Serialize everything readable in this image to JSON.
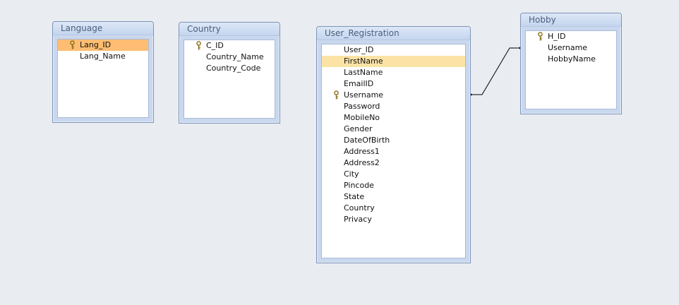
{
  "tables": {
    "language": {
      "title": "Language",
      "fields": [
        {
          "name": "Lang_ID",
          "key": true,
          "highlight": "strong"
        },
        {
          "name": "Lang_Name",
          "key": false
        }
      ]
    },
    "country": {
      "title": "Country",
      "fields": [
        {
          "name": "C_ID",
          "key": true
        },
        {
          "name": "Country_Name",
          "key": false
        },
        {
          "name": "Country_Code",
          "key": false
        }
      ]
    },
    "user_registration": {
      "title": "User_Registration",
      "fields": [
        {
          "name": "User_ID",
          "key": false
        },
        {
          "name": "FirstName",
          "key": false,
          "highlight": "soft"
        },
        {
          "name": "LastName",
          "key": false
        },
        {
          "name": "EmailID",
          "key": false
        },
        {
          "name": "Username",
          "key": true
        },
        {
          "name": "Password",
          "key": false
        },
        {
          "name": "MobileNo",
          "key": false
        },
        {
          "name": "Gender",
          "key": false
        },
        {
          "name": "DateOfBirth",
          "key": false
        },
        {
          "name": "Address1",
          "key": false
        },
        {
          "name": "Address2",
          "key": false
        },
        {
          "name": "City",
          "key": false
        },
        {
          "name": "Pincode",
          "key": false
        },
        {
          "name": "State",
          "key": false
        },
        {
          "name": "Country",
          "key": false
        },
        {
          "name": "Privacy",
          "key": false
        }
      ]
    },
    "hobby": {
      "title": "Hobby",
      "fields": [
        {
          "name": "H_ID",
          "key": true
        },
        {
          "name": "Username",
          "key": false
        },
        {
          "name": "HobbyName",
          "key": false
        }
      ]
    }
  },
  "relationships": [
    {
      "from_table": "user_registration",
      "from_field": "Username",
      "to_table": "hobby",
      "to_field": "Username"
    }
  ],
  "icons": {
    "key_field": "primary-key-icon"
  },
  "colors": {
    "background": "#e9ecf1",
    "header": "#c9d8ee",
    "selected_strong": "#fdbd72",
    "selected_soft": "#fbe3a6",
    "line": "#000000"
  }
}
